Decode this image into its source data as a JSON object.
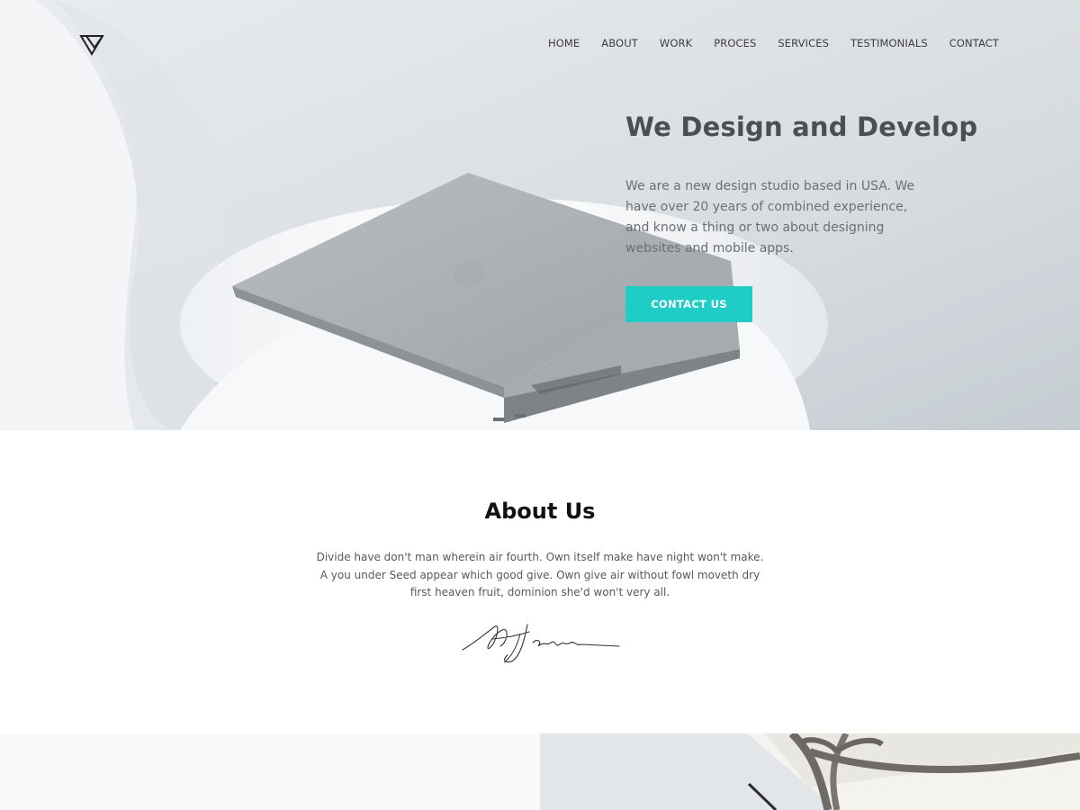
{
  "nav": {
    "items": [
      "HOME",
      "ABOUT",
      "WORK",
      "PROCES",
      "SERVICES",
      "TESTIMONIALS",
      "CONTACT"
    ]
  },
  "hero": {
    "title": "We Design and Develop",
    "text": "We are a new design studio based in USA. We have over 20 years of combined experience, and know a thing or two about designing websites and mobile apps.",
    "cta_label": "CONTACT US"
  },
  "about": {
    "title": "About Us",
    "text": "Divide have don't man wherein air fourth. Own itself make have night won't make. A you under Seed appear which good give. Own give air without fowl moveth dry first heaven fruit, dominion she'd won't very all."
  },
  "colors": {
    "accent": "#1ecec6",
    "heading": "#111111",
    "hero_heading": "#4a4f53",
    "body_text": "#6a7075"
  },
  "icons": {
    "logo": "triangle-logo-icon"
  }
}
